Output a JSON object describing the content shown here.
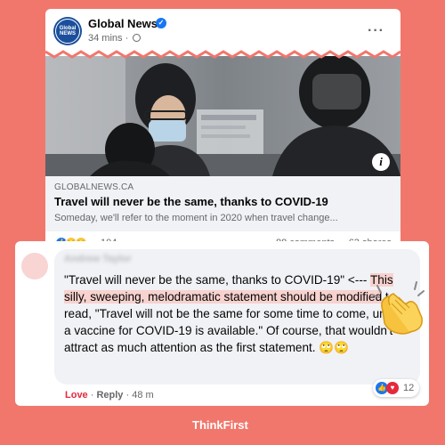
{
  "post": {
    "page_name": "Global News",
    "logo_text_line1": "Global",
    "logo_text_line2": "NEWS",
    "timestamp": "34 mins · ",
    "link": {
      "domain": "GLOBALNEWS.CA",
      "title": "Travel will never be the same, thanks to COVID-19",
      "description": "Someday, we'll refer to the moment in 2020 when travel change..."
    },
    "reactions": {
      "icons": [
        "like-icon",
        "sad-icon",
        "haha-icon"
      ],
      "count": "104",
      "comments": "88 comments",
      "shares": "63 shares"
    }
  },
  "comment": {
    "author": "Andrew Taylor",
    "text_part1": "\"Travel will never be the same, thanks to COVID-19\" <--- ",
    "text_highlight": "This silly, sweeping, melodramatic statement should be modified",
    "text_part2": " to read, \"Travel will not be the same for some time to come, until a vaccine for COVID-19 is available.\" Of course, that wouldn't attract as much attention as the first statement. 🙄🙄",
    "actions": {
      "love": "Love",
      "separator": " · ",
      "reply": "Reply",
      "age": " · 48 m"
    },
    "reaction_count": "12"
  },
  "footer": {
    "brand": "ThinkFirst"
  },
  "colors": {
    "background": "#f1776d",
    "highlight": "#f7d2cf",
    "love": "#e5283c",
    "facebook_blue": "#1877f2"
  }
}
